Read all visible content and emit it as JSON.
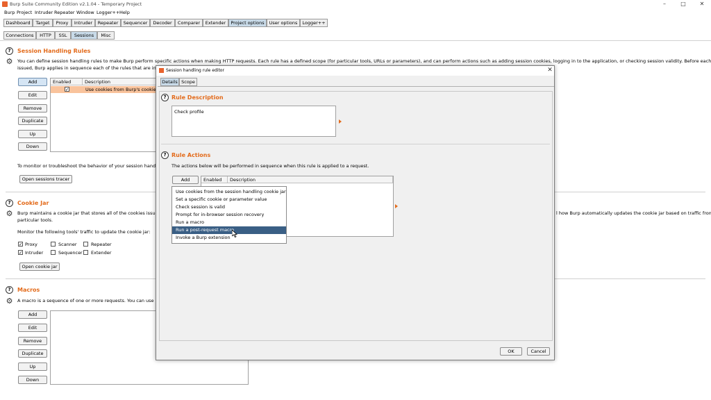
{
  "window": {
    "title": "Burp Suite Community Edition v2.1.04 - Temporary Project",
    "minimize": "–",
    "maximize": "□",
    "close": "✕"
  },
  "menu": [
    "Burp",
    "Project",
    "Intruder",
    "Repeater",
    "Window",
    "Logger++",
    "Help"
  ],
  "main_tabs": [
    "Dashboard",
    "Target",
    "Proxy",
    "Intruder",
    "Repeater",
    "Sequencer",
    "Decoder",
    "Comparer",
    "Extender",
    "Project options",
    "User options",
    "Logger++"
  ],
  "main_tab_selected": "Project options",
  "sub_tabs": [
    "Connections",
    "HTTP",
    "SSL",
    "Sessions",
    "Misc"
  ],
  "sub_tab_selected": "Sessions",
  "session_rules": {
    "title": "Session Handling Rules",
    "desc_line1": "You can define session handling rules to make Burp perform specific actions when making HTTP requests. Each rule has a defined scope (for particular tools, URLs or parameters), and can perform actions such as adding session cookies, logging in to the application, or checking session validity. Before each request is",
    "desc_line2": "issued, Burp applies in sequence each of the rules that are in-sc",
    "buttons": [
      "Add",
      "Edit",
      "Remove",
      "Duplicate",
      "Up",
      "Down"
    ],
    "columns": [
      "Enabled",
      "Description"
    ],
    "rows": [
      {
        "enabled": "✓",
        "description": "Use cookies from Burp's cookie"
      }
    ],
    "monitor_text": "To monitor or troubleshoot the behavior of your session handling",
    "tracer_button": "Open sessions tracer"
  },
  "cookie_jar": {
    "title": "Cookie Jar",
    "desc_line1": "Burp maintains a cookie jar that stores all of the cookies issued",
    "desc_line1_right": "l how Burp automatically updates the cookie jar based on traffic from",
    "desc_line2": "particular tools.",
    "monitor_label": "Monitor the following tools' traffic to update the cookie jar:",
    "tools": [
      {
        "name": "Proxy",
        "checked": "✓"
      },
      {
        "name": "Scanner",
        "checked": ""
      },
      {
        "name": "Repeater",
        "checked": ""
      },
      {
        "name": "Intruder",
        "checked": "✓"
      },
      {
        "name": "Sequencer",
        "checked": ""
      },
      {
        "name": "Extender",
        "checked": ""
      }
    ],
    "open_button": "Open cookie jar"
  },
  "macros": {
    "title": "Macros",
    "desc": "A macro is a sequence of one or more requests. You can use m",
    "buttons": [
      "Add",
      "Edit",
      "Remove",
      "Duplicate",
      "Up",
      "Down"
    ]
  },
  "dialog": {
    "title": "Session handling rule editor",
    "close": "✕",
    "tabs": [
      "Details",
      "Scope"
    ],
    "tab_selected": "Details",
    "rule_description": {
      "title": "Rule Description",
      "value": "Check profile"
    },
    "rule_actions": {
      "title": "Rule Actions",
      "desc": "The actions below will be performed in sequence when this rule is applied to a request.",
      "add_button": "Add",
      "columns": [
        "Enabled",
        "Description"
      ],
      "dropdown": [
        "Use cookies from the session handling cookie jar",
        "Set a specific cookie or parameter value",
        "Check session is valid",
        "Prompt for in-browser session recovery",
        "Run a macro",
        "Run a post-request macro",
        "Invoke a Burp extension"
      ],
      "dropdown_highlighted": "Run a post-request macro"
    },
    "ok": "OK",
    "cancel": "Cancel"
  },
  "colors": {
    "accent": "#e36b1b",
    "selected_tab": "#c9dbe9",
    "highlight": "#3a5f85",
    "table_row_selected": "#f9c39c"
  },
  "icons": [
    "burp-logo-icon",
    "help-icon",
    "gear-icon",
    "submenu-arrow-icon",
    "mouse-cursor-icon"
  ]
}
